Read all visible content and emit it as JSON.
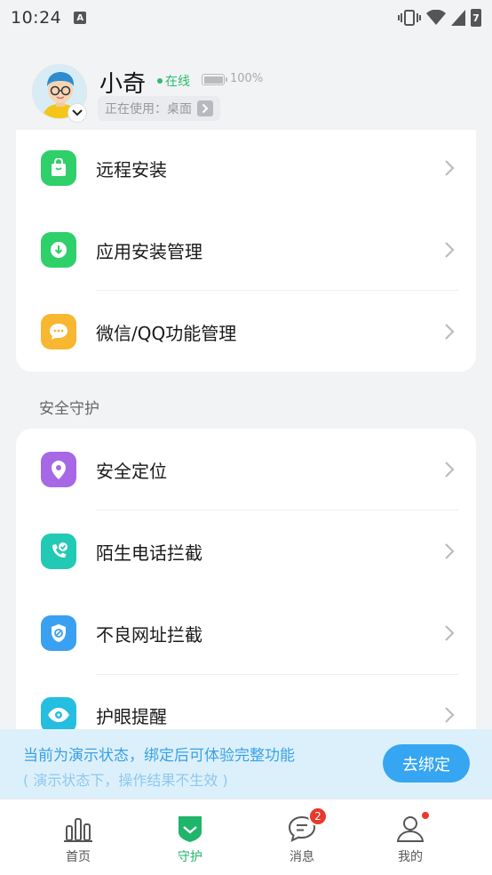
{
  "status_bar": {
    "time": "10:24",
    "notification_letter": "A",
    "battery_badge": "7"
  },
  "profile": {
    "name": "小奇",
    "status": "在线",
    "battery_level": 1.0,
    "battery_text": "100%",
    "using_text": "正在使用：桌面"
  },
  "menu_group_1": [
    {
      "label": "远程安装",
      "icon": "shopping-bag-icon",
      "color": "#2fcf6a"
    },
    {
      "label": "应用安装管理",
      "icon": "download-icon",
      "color": "#2fcf6a"
    },
    {
      "label": "微信/QQ功能管理",
      "icon": "chat-bubble-icon",
      "color": "#f7b731"
    }
  ],
  "section_title": "安全守护",
  "menu_group_2": [
    {
      "label": "安全定位",
      "icon": "location-pin-icon",
      "color": "#a768e6"
    },
    {
      "label": "陌生电话拦截",
      "icon": "phone-check-icon",
      "color": "#22c9b4"
    },
    {
      "label": "不良网址拦截",
      "icon": "shield-block-icon",
      "color": "#3aa0f2"
    },
    {
      "label": "护眼提醒",
      "icon": "eye-icon",
      "color": "#25bde0"
    }
  ],
  "demo_banner": {
    "line1": "当前为演示状态，绑定后可体验完整功能",
    "line2": "( 演示状态下，操作结果不生效 )",
    "button": "去绑定"
  },
  "tabs": [
    {
      "label": "首页",
      "icon": "bar-chart-icon",
      "active": false
    },
    {
      "label": "守护",
      "icon": "shield-check-icon",
      "active": true
    },
    {
      "label": "消息",
      "icon": "message-icon",
      "active": false,
      "badge": "2"
    },
    {
      "label": "我的",
      "icon": "person-icon",
      "active": false,
      "dot": true
    }
  ],
  "colors": {
    "accent_green": "#1fb56a",
    "banner_blue": "#36a6f2",
    "badge_red": "#e8392c"
  }
}
